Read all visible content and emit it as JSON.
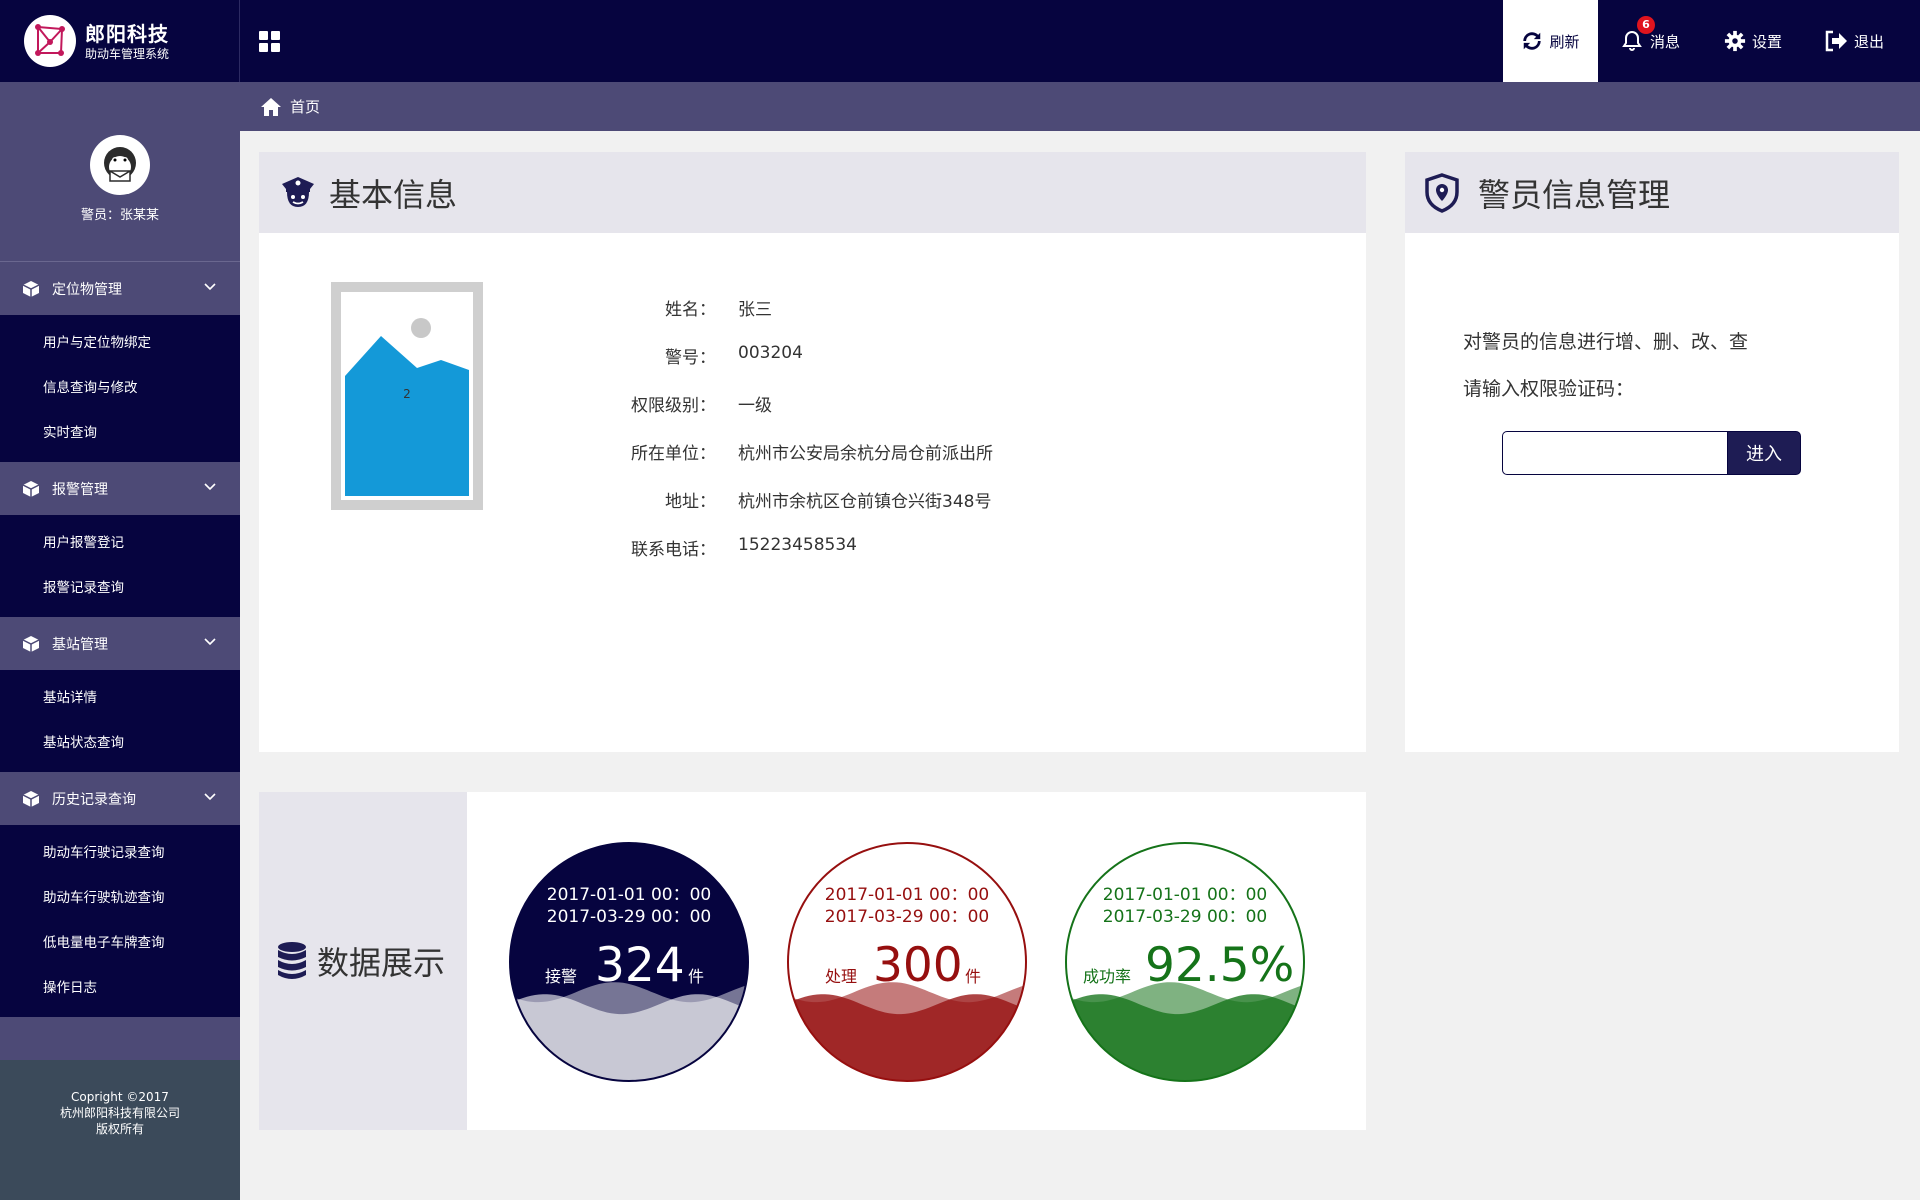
{
  "app": {
    "name": "郎阳科技",
    "subtitle": "助动车管理系统"
  },
  "topbar": {
    "refresh_label": "刷新",
    "messages_label": "消息",
    "messages_count": "6",
    "settings_label": "设置",
    "logout_label": "退出"
  },
  "user": {
    "display": "警员：张某某"
  },
  "sidebar": {
    "groups": [
      {
        "title": "定位物管理",
        "items": [
          "用户与定位物绑定",
          "信息查询与修改",
          "实时查询"
        ]
      },
      {
        "title": "报警管理",
        "items": [
          "用户报警登记",
          "报警记录查询"
        ]
      },
      {
        "title": "基站管理",
        "items": [
          "基站详情",
          "基站状态查询"
        ]
      },
      {
        "title": "历史记录查询",
        "items": [
          "助动车行驶记录查询",
          "助动车行驶轨迹查询",
          "低电量电子车牌查询",
          "操作日志"
        ]
      }
    ],
    "footer": {
      "line1": "Copright ©2017",
      "line2": "杭州郎阳科技有限公司",
      "line3": "版权所有"
    }
  },
  "breadcrumb": {
    "home": "首页"
  },
  "basic_info": {
    "title": "基本信息",
    "photo_placeholder": "2",
    "fields": [
      {
        "label": "姓名：",
        "value": "张三"
      },
      {
        "label": "警号：",
        "value": "003204"
      },
      {
        "label": "权限级别：",
        "value": "一级"
      },
      {
        "label": "所在单位：",
        "value": "杭州市公安局余杭分局仓前派出所"
      },
      {
        "label": "地址：",
        "value": "杭州市余杭区仓前镇仓兴街348号"
      },
      {
        "label": "联系电话：",
        "value": "15223458534"
      }
    ]
  },
  "officer_mgmt": {
    "title": "警员信息管理",
    "description": "对警员的信息进行增、删、改、查",
    "prompt": "请输入权限验证码：",
    "input_value": "",
    "enter_label": "进入"
  },
  "stats": {
    "title": "数据展示",
    "gauges": [
      {
        "from": "2017-01-01 00：00",
        "to": "2017-03-29 00：00",
        "prefix": "接警",
        "value": "324",
        "suffix": "件",
        "level": 0.36,
        "color": "#06043f"
      },
      {
        "from": "2017-01-01 00：00",
        "to": "2017-03-29 00：00",
        "prefix": "处理",
        "value": "300",
        "suffix": "件",
        "level": 0.36,
        "color": "#960f0f"
      },
      {
        "from": "2017-01-01 00：00",
        "to": "2017-03-29 00：00",
        "prefix": "成功率",
        "value": "92.5%",
        "suffix": "",
        "level": 0.36,
        "color": "#157319"
      }
    ]
  }
}
